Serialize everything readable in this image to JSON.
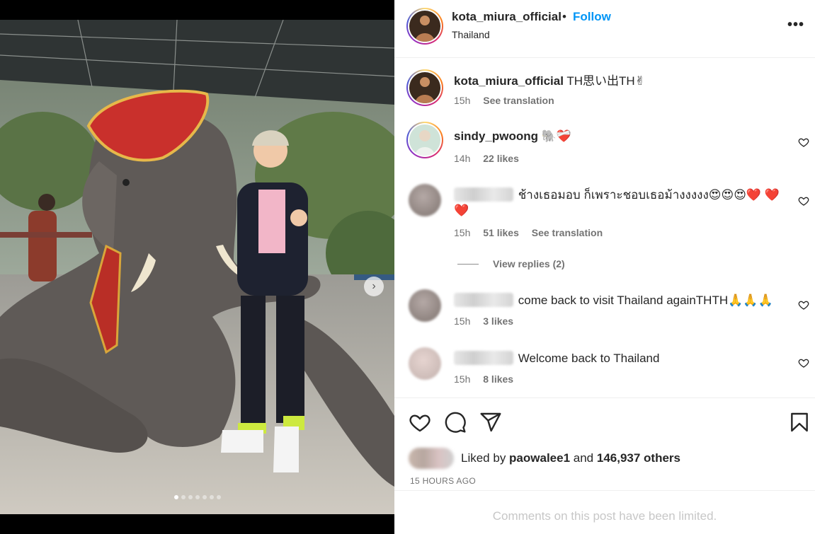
{
  "post": {
    "photo_alt_icon": "elephant-photo",
    "carousel": {
      "slide_count": 7,
      "active_index": 0
    },
    "next_icon": "chevron-right-icon"
  },
  "header": {
    "username": "kota_miura_official",
    "separator": "•",
    "follow_label": "Follow",
    "location": "Thailand",
    "more_label": "•••"
  },
  "caption": {
    "username": "kota_miura_official",
    "text": "TH思い出TH✌",
    "time": "15h",
    "translate": "See translation"
  },
  "comments": [
    {
      "username": "sindy_pwoong",
      "text": "🐘❤️‍🩹",
      "time": "14h",
      "likes": "22 likes"
    },
    {
      "username": "",
      "text": "ช้างเธอมอบ ก็เพราะชอบเธอม้างงงงง😍😍😍❤️ ❤️❤️",
      "time": "15h",
      "likes": "51 likes",
      "translate": "See translation"
    },
    {
      "username": "",
      "text": "come back to visit Thailand againTHTH🙏🙏🙏",
      "time": "15h",
      "likes": "3 likes"
    },
    {
      "username": "",
      "text": "Welcome back to Thailand",
      "time": "15h",
      "likes": "8 likes"
    }
  ],
  "view_replies": "View replies (2)",
  "likes": {
    "prefix": "Liked by ",
    "user": "paowalee1",
    "middle": " and ",
    "others": "146,937 others"
  },
  "time_ago": "15 HOURS AGO",
  "limited_notice": "Comments on this post have been limited.",
  "colors": {
    "follow": "#0095f6",
    "text": "#262626",
    "muted": "#737373"
  }
}
